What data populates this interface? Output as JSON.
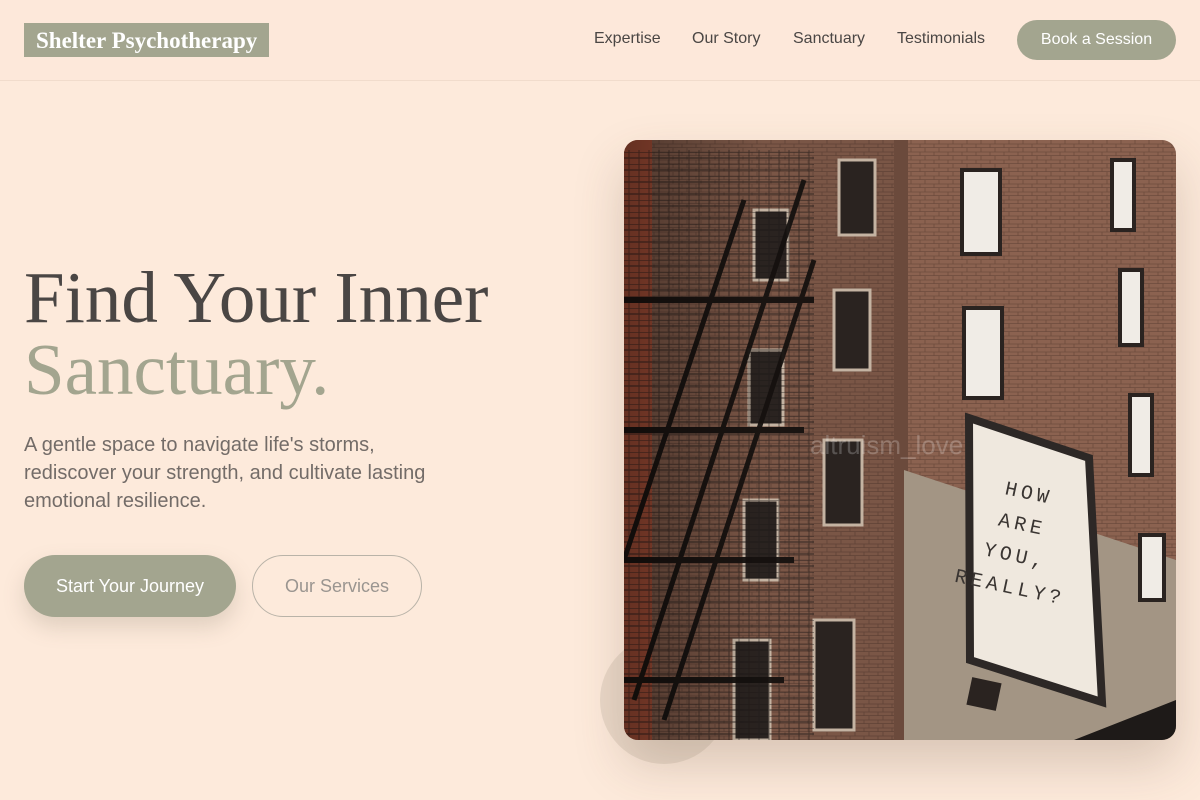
{
  "brand": {
    "name": "Shelter Psychotherapy"
  },
  "nav": {
    "items": [
      "Expertise",
      "Our Story",
      "Sanctuary",
      "Testimonials"
    ],
    "cta": "Book a Session"
  },
  "hero": {
    "title_line1": "Find Your Inner",
    "title_line2": "Sanctuary.",
    "subtitle": "A gentle space to navigate life's storms, rediscover your strength, and cultivate lasting emotional resilience.",
    "primary_button": "Start Your Journey",
    "secondary_button": "Our Services"
  },
  "image": {
    "mural_lines": [
      "HOW",
      "ARE",
      "YOU,",
      "REALLY?"
    ],
    "watermark": "altruism_love"
  },
  "colors": {
    "background": "#fdeadb",
    "accent": "#a3a58f",
    "text": "#4a4644",
    "muted_text": "#736c68"
  }
}
